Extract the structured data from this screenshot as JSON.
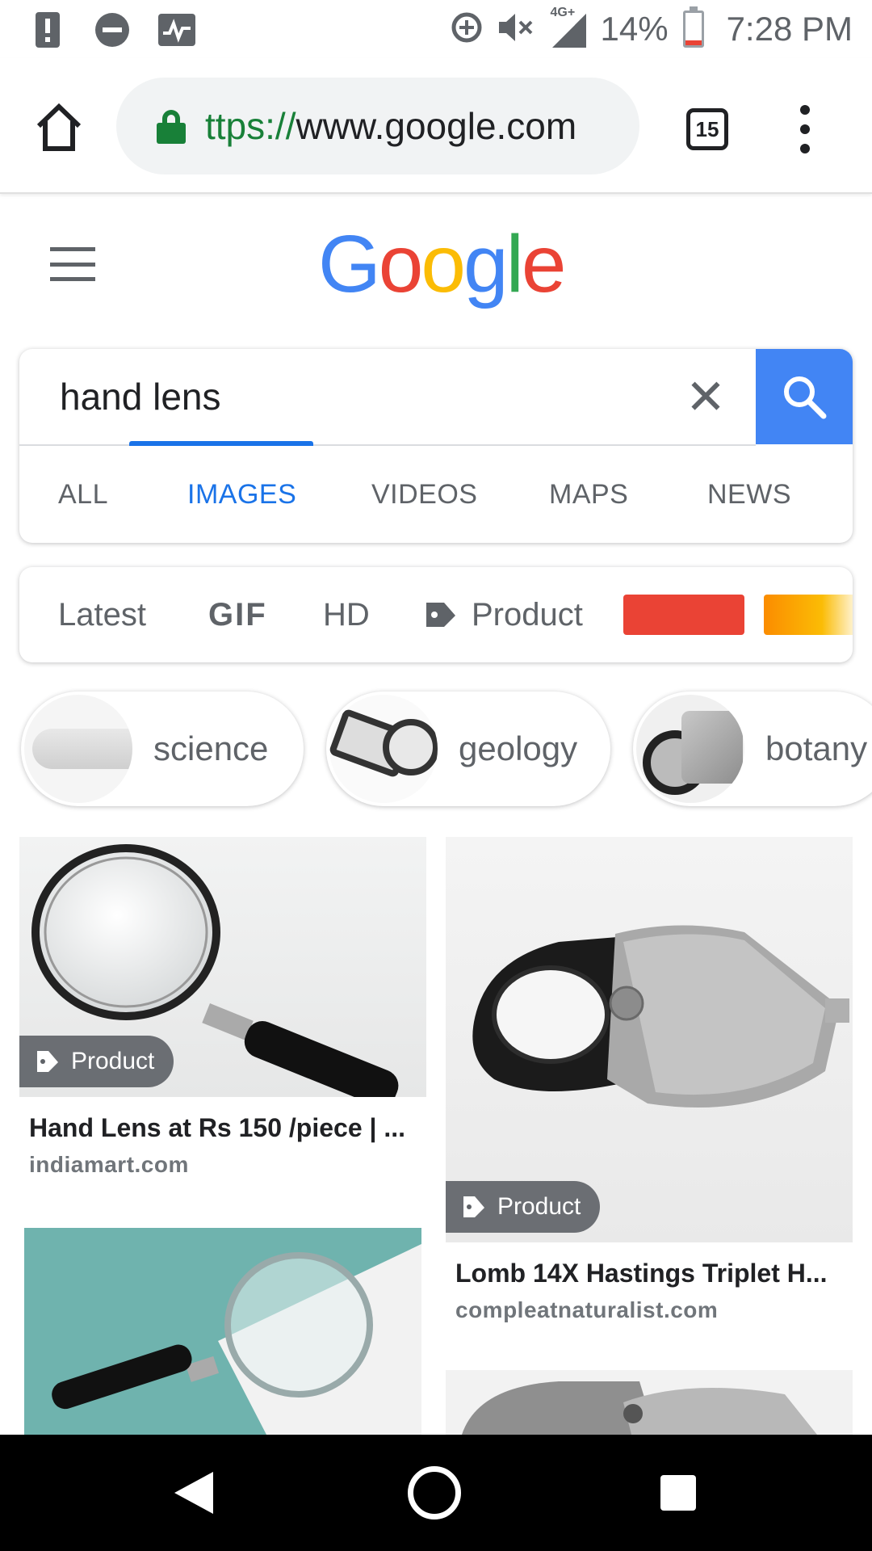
{
  "status_bar": {
    "network": "4G+",
    "battery": "14%",
    "battery_level": 0.14,
    "time": "7:28 PM",
    "icons": [
      "alert-icon",
      "dnd-icon",
      "activity-icon",
      "data-saver-icon",
      "mute-icon",
      "signal-icon",
      "battery-icon"
    ]
  },
  "browser": {
    "url_scheme": "ttps://",
    "url_host": "www.google.com",
    "tab_count": "15"
  },
  "search": {
    "query": "hand lens",
    "tabs": [
      {
        "label": "ALL"
      },
      {
        "label": "IMAGES"
      },
      {
        "label": "VIDEOS"
      },
      {
        "label": "MAPS"
      },
      {
        "label": "NEWS"
      }
    ],
    "active_tab": "IMAGES"
  },
  "filters": {
    "latest": "Latest",
    "gif": "GIF",
    "hd": "HD",
    "product": "Product",
    "swatch_colors": [
      "#ea4335",
      "#fb8c00"
    ]
  },
  "related": [
    {
      "label": "science"
    },
    {
      "label": "geology"
    },
    {
      "label": "botany"
    }
  ],
  "results": [
    {
      "badge": "Product",
      "title": "Hand Lens at Rs 150 /piece | ...",
      "site": "indiamart.com"
    },
    {
      "badge": "Product",
      "title": "Lomb 14X Hastings Triplet H...",
      "site": "compleatnaturalist.com"
    }
  ],
  "colors": {
    "accent": "#1a73e8",
    "search_button": "#4285f4",
    "lock": "#188038"
  }
}
